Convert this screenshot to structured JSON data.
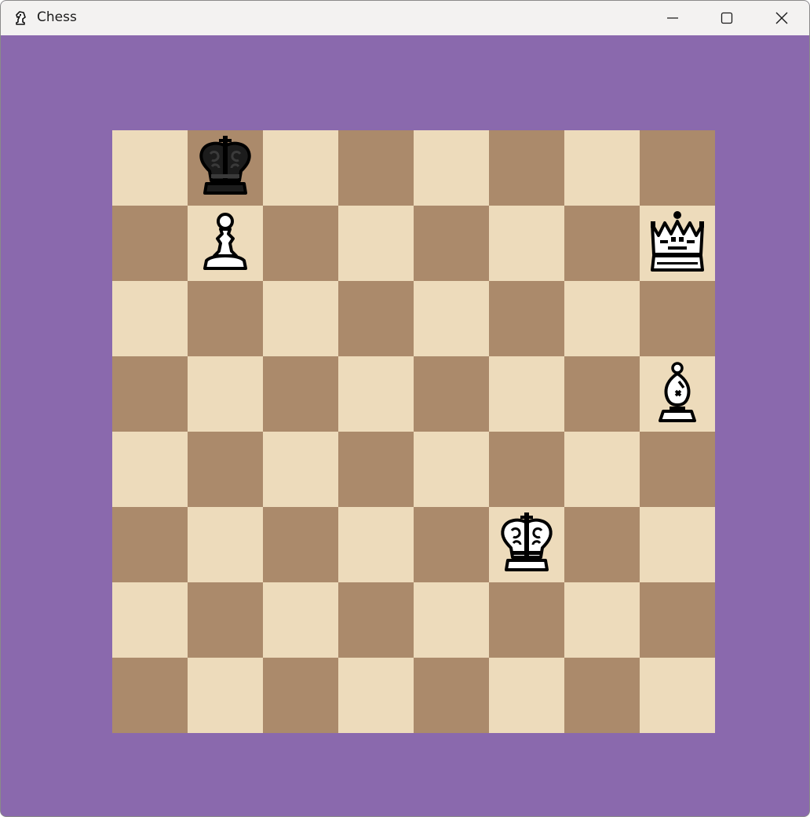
{
  "window": {
    "title": "Chess",
    "app_icon": "chess-knight-icon",
    "controls": [
      "minimize-icon",
      "maximize-icon",
      "close-icon"
    ]
  },
  "colors": {
    "frame": "#8a69ad",
    "light_square": "#eddbbb",
    "dark_square": "#ab8a6b",
    "titlebar": "#f3f2f1"
  },
  "board": {
    "rows": [
      [
        "",
        "bK",
        "",
        "",
        "",
        "",
        "",
        ""
      ],
      [
        "",
        "wP",
        "",
        "",
        "",
        "",
        "",
        "wQ"
      ],
      [
        "",
        "",
        "",
        "",
        "",
        "",
        "",
        ""
      ],
      [
        "",
        "",
        "",
        "",
        "",
        "",
        "",
        "wB"
      ],
      [
        "",
        "",
        "",
        "",
        "",
        "",
        "",
        ""
      ],
      [
        "",
        "",
        "",
        "",
        "",
        "wK",
        "",
        ""
      ],
      [
        "",
        "",
        "",
        "",
        "",
        "",
        "",
        ""
      ],
      [
        "",
        "",
        "",
        "",
        "",
        "",
        "",
        ""
      ]
    ]
  }
}
